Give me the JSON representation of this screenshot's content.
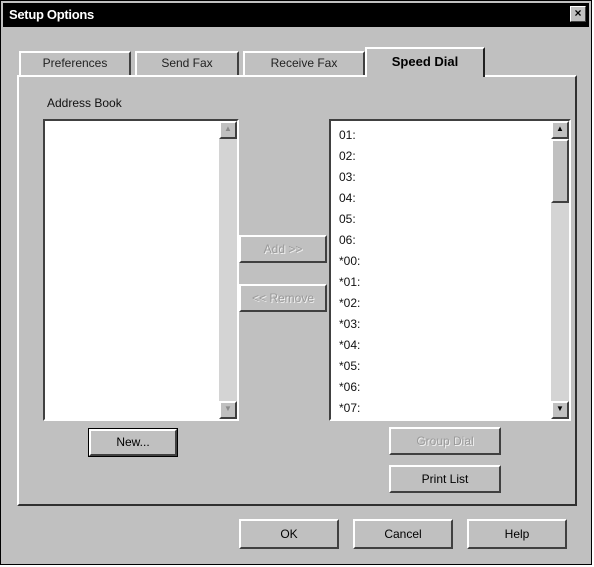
{
  "window": {
    "title": "Setup Options",
    "close_glyph": "×"
  },
  "tabs": [
    {
      "label": "Preferences",
      "active": false
    },
    {
      "label": "Send Fax",
      "active": false
    },
    {
      "label": "Receive Fax",
      "active": false
    },
    {
      "label": "Speed Dial",
      "active": true
    }
  ],
  "address_book": {
    "label": "Address Book",
    "items": [],
    "scroll_up_icon": "scroll-up-arrow",
    "scroll_down_icon": "scroll-down-arrow"
  },
  "transfer_buttons": {
    "add": {
      "label": "Add >>",
      "enabled": false
    },
    "remove": {
      "label": "<< Remove",
      "enabled": false
    }
  },
  "speed_dial": {
    "entries": [
      "01:",
      "02:",
      "03:",
      "04:",
      "05:",
      "06:",
      "*00:",
      "*01:",
      "*02:",
      "*03:",
      "*04:",
      "*05:",
      "*06:",
      "*07:"
    ]
  },
  "buttons": {
    "new": {
      "label": "New..."
    },
    "group_dial": {
      "label": "Group Dial",
      "enabled": false
    },
    "print_list": {
      "label": "Print List"
    },
    "ok": {
      "label": "OK"
    },
    "cancel": {
      "label": "Cancel"
    },
    "help": {
      "label": "Help"
    }
  },
  "colors": {
    "dialog_face": "#c0c0c0",
    "titlebar": "#000000",
    "list_background": "#ffffff"
  }
}
